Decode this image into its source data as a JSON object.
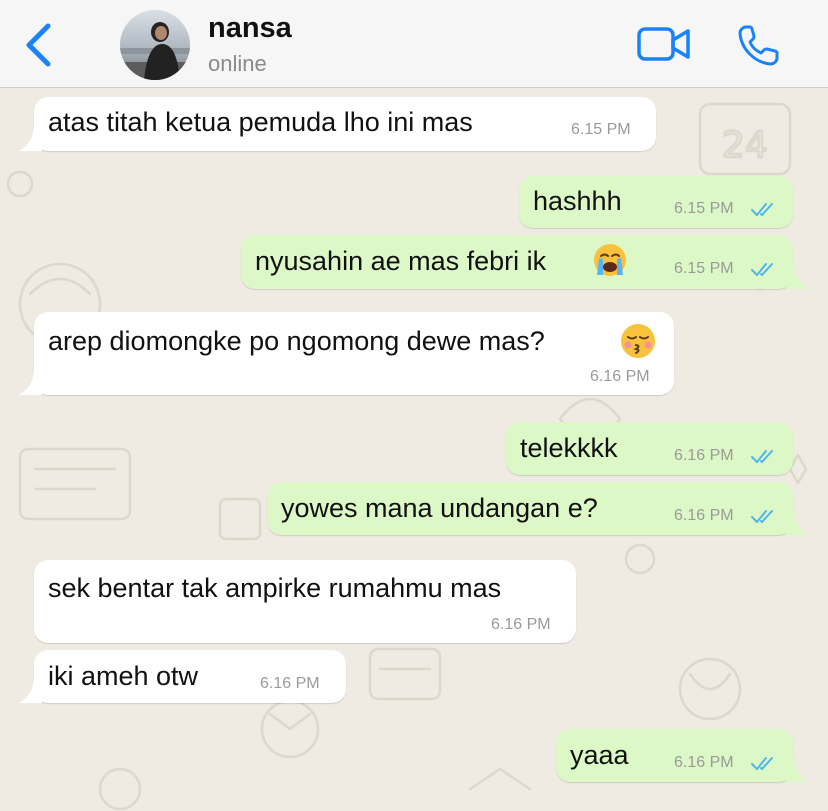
{
  "header": {
    "contact_name": "nansa",
    "status": "online"
  },
  "colors": {
    "accent": "#1a82fb",
    "incoming_bubble": "#ffffff",
    "outgoing_bubble": "#dcf8c6",
    "read_ticks": "#4fb6ec",
    "wallpaper": "#efeae2"
  },
  "messages": [
    {
      "direction": "incoming",
      "text": "atas titah ketua pemuda lho ini mas",
      "time": "6.15 PM"
    },
    {
      "direction": "outgoing",
      "text": "hashhh",
      "time": "6.15 PM",
      "status": "read"
    },
    {
      "direction": "outgoing",
      "text": "nyusahin ae mas febri ik",
      "emoji": "loudly-crying-face",
      "time": "6.15 PM",
      "status": "read"
    },
    {
      "direction": "incoming",
      "text": "arep diomongke po ngomong dewe mas?",
      "emoji": "kissing-face",
      "time": "6.16 PM"
    },
    {
      "direction": "outgoing",
      "text": "telekkkk",
      "time": "6.16 PM",
      "status": "read"
    },
    {
      "direction": "outgoing",
      "text": "yowes mana undangan e?",
      "time": "6.16 PM",
      "status": "read"
    },
    {
      "direction": "incoming",
      "text": "sek bentar tak ampirke rumahmu mas",
      "time": "6.16 PM"
    },
    {
      "direction": "incoming",
      "text": "iki ameh otw",
      "time": "6.16 PM"
    },
    {
      "direction": "outgoing",
      "text": "yaaa",
      "time": "6.16 PM",
      "status": "read"
    }
  ]
}
